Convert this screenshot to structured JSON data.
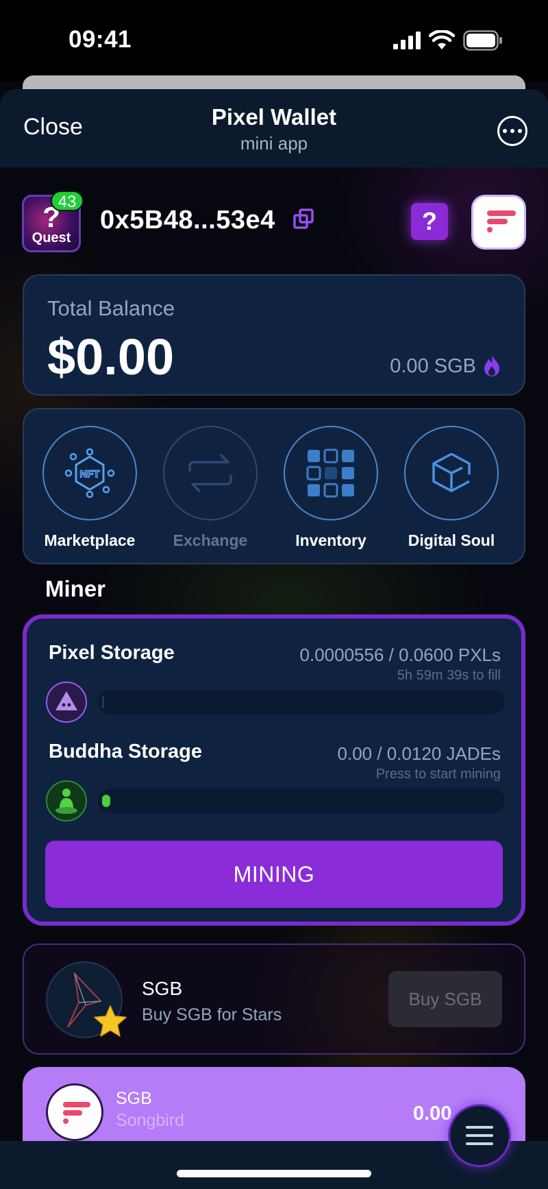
{
  "status": {
    "time": "09:41"
  },
  "header": {
    "close_label": "Close",
    "title": "Pixel Wallet",
    "subtitle": "mini app"
  },
  "wallet": {
    "quest_badge": "43",
    "quest_label": "Quest",
    "quest_mark": "?",
    "address": "0x5B48...53e4"
  },
  "balance": {
    "label": "Total Balance",
    "value": "$0.00",
    "sgb": "0.00 SGB"
  },
  "actions": [
    {
      "label": "Marketplace",
      "icon": "nft-icon",
      "enabled": true
    },
    {
      "label": "Exchange",
      "icon": "exchange-icon",
      "enabled": false
    },
    {
      "label": "Inventory",
      "icon": "grid-icon",
      "enabled": true
    },
    {
      "label": "Digital Soul",
      "icon": "cube-icon",
      "enabled": true
    }
  ],
  "miner": {
    "title": "Miner",
    "pixel": {
      "name": "Pixel Storage",
      "value": "0.0000556 / 0.0600 PXLs",
      "hint": "5h 59m 39s to fill",
      "progress": 0.001
    },
    "buddha": {
      "name": "Buddha Storage",
      "value": "0.00 / 0.0120 JADEs",
      "hint": "Press to start mining",
      "progress": 0.02
    },
    "button_label": "MINING"
  },
  "sgb_promo": {
    "name": "SGB",
    "desc": "Buy SGB for Stars",
    "button_label": "Buy SGB"
  },
  "token": {
    "name": "SGB",
    "subtitle": "Songbird",
    "amount": "0.00"
  },
  "colors": {
    "accent_purple": "#8a2cd8",
    "card_bg": "#0f2340",
    "quest_badge_green": "#1fcf3a"
  }
}
